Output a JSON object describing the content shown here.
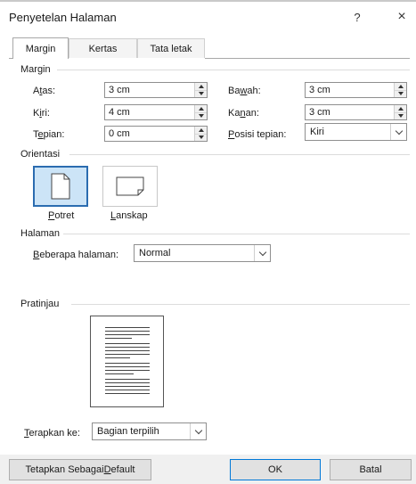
{
  "dialog": {
    "title": "Penyetelan Halaman",
    "help": "?",
    "close": "×"
  },
  "tabs": [
    {
      "label": "Margin",
      "active": true
    },
    {
      "label": "Kertas",
      "active": false
    },
    {
      "label": "Tata letak",
      "active": false
    }
  ],
  "margin": {
    "group_label": "Margin",
    "atas": {
      "label_pre": "A",
      "label_ul": "t",
      "label_post": "as:",
      "value": "3 cm"
    },
    "bawah": {
      "label_pre": "Ba",
      "label_ul": "w",
      "label_post": "ah:",
      "value": "3 cm"
    },
    "kiri": {
      "label_pre": "K",
      "label_ul": "i",
      "label_post": "ri:",
      "value": "4 cm"
    },
    "kanan": {
      "label_pre": "Ka",
      "label_ul": "n",
      "label_post": "an:",
      "value": "3 cm"
    },
    "tepian": {
      "label_pre": "T",
      "label_ul": "e",
      "label_post": "pian:",
      "value": "0 cm"
    },
    "posisi_tepian": {
      "label_pre": "",
      "label_ul": "P",
      "label_post": "osisi tepian:",
      "value": "Kiri"
    }
  },
  "orientasi": {
    "group_label": "Orientasi",
    "potret": {
      "label_ul": "P",
      "label_post": "otret",
      "selected": true
    },
    "lanskap": {
      "label_ul": "L",
      "label_post": "anskap",
      "selected": false
    }
  },
  "halaman": {
    "group_label": "Halaman",
    "beberapa": {
      "label_ul": "B",
      "label_post": "eberapa halaman:",
      "value": "Normal"
    }
  },
  "pratinjau": {
    "group_label": "Pratinjau"
  },
  "terapkan": {
    "label_ul": "T",
    "label_post": "erapkan ke:",
    "value": "Bagian terpilih"
  },
  "footer": {
    "default_pre": "Tetapkan Sebagai ",
    "default_ul": "D",
    "default_post": "efault",
    "ok": "OK",
    "batal": "Batal"
  },
  "colors": {
    "accent": "#0078d7",
    "selected_bg": "#cce4f7"
  }
}
